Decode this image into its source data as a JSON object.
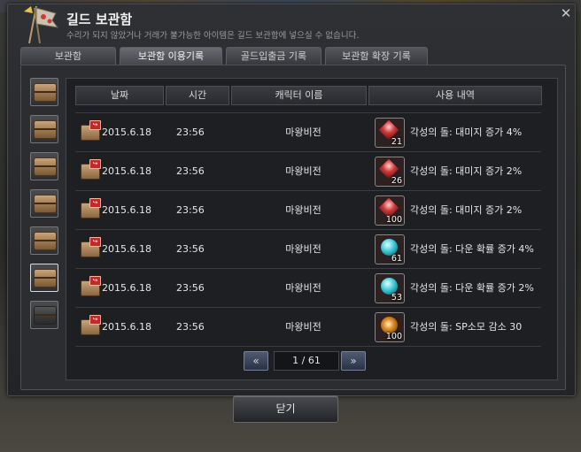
{
  "window": {
    "title": "길드 보관함",
    "subtitle": "수리가 되지 않았거나 거래가 불가능한 아이템은 길드 보관함에 넣으실 수 없습니다.",
    "close_symbol": "✕"
  },
  "tabs": [
    {
      "label": "보관함",
      "active": false
    },
    {
      "label": "보관함 이용기록",
      "active": true
    },
    {
      "label": "골드입출금 기록",
      "active": false
    },
    {
      "label": "보관함 확장 기록",
      "active": false
    }
  ],
  "columns": [
    "날짜",
    "시간",
    "캐릭터 이름",
    "사용 내역"
  ],
  "rows": [
    {
      "date": "2015.6.18",
      "time": "23:56",
      "character": "마왕비전",
      "item_icon": "red-gem-icon",
      "item_count": "21",
      "description": "각성의 돌: 대미지 증가 4%"
    },
    {
      "date": "2015.6.18",
      "time": "23:56",
      "character": "마왕비전",
      "item_icon": "red-gem-icon",
      "item_count": "26",
      "description": "각성의 돌: 대미지 증가 2%"
    },
    {
      "date": "2015.6.18",
      "time": "23:56",
      "character": "마왕비전",
      "item_icon": "red-gem-icon",
      "item_count": "100",
      "description": "각성의 돌: 대미지 증가 2%"
    },
    {
      "date": "2015.6.18",
      "time": "23:56",
      "character": "마왕비전",
      "item_icon": "blue-gem-icon",
      "item_count": "61",
      "description": "각성의 돌: 다운 확률 증가 4%"
    },
    {
      "date": "2015.6.18",
      "time": "23:56",
      "character": "마왕비전",
      "item_icon": "blue-gem-icon",
      "item_count": "53",
      "description": "각성의 돌: 다운 확률 증가 2%"
    },
    {
      "date": "2015.6.18",
      "time": "23:56",
      "character": "마왕비전",
      "item_icon": "orange-gem-icon",
      "item_count": "100",
      "description": "각성의 돌: SP소모 감소 30"
    }
  ],
  "pager": {
    "prev_symbol": "«",
    "next_symbol": "»",
    "display": "1 / 61"
  },
  "close_button": {
    "label": "닫기"
  },
  "colors": {
    "accent_red": "#c62828",
    "gem_red": "#d23838",
    "gem_blue": "#39c9d8",
    "gem_orange": "#e08a22"
  }
}
